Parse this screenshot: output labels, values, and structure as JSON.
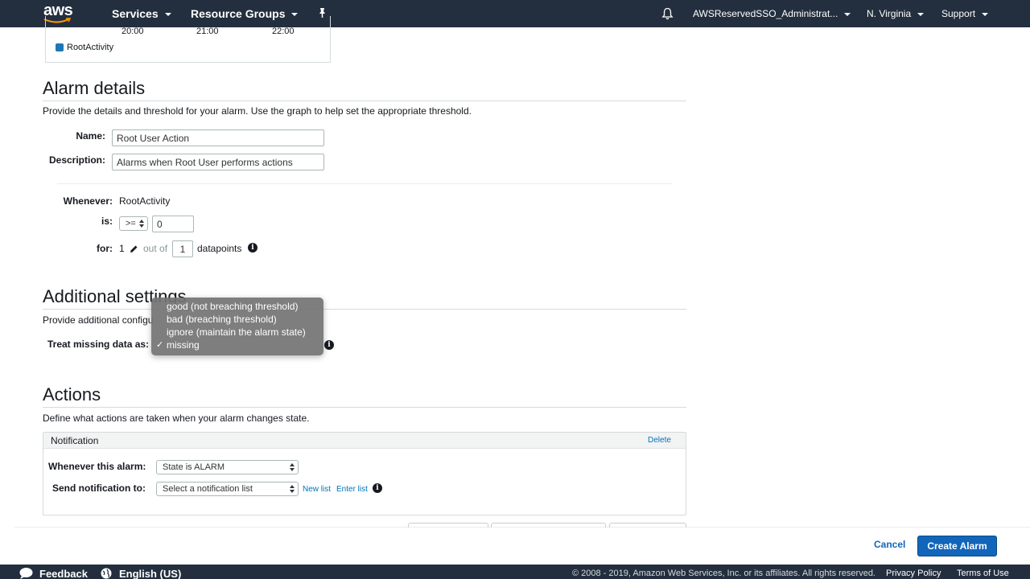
{
  "topnav": {
    "logo": "aws",
    "services": "Services",
    "resource_groups": "Resource Groups",
    "account": "AWSReservedSSO_Administrat...",
    "region": "N. Virginia",
    "support": "Support"
  },
  "graph": {
    "x_ticks": [
      "20:00",
      "21:00",
      "22:00"
    ],
    "legend": "RootActivity",
    "legend_color": "#1f77b4"
  },
  "alarm_details": {
    "title": "Alarm details",
    "description": "Provide the details and threshold for your alarm. Use the graph to help set the appropriate threshold.",
    "name_label": "Name:",
    "name_value": "Root User Action",
    "description_label": "Description:",
    "description_value": "Alarms when Root User performs actions",
    "whenever_label": "Whenever:",
    "whenever_value": "RootActivity",
    "is_label": "is:",
    "operator": ">=",
    "threshold": "0",
    "for_label": "for:",
    "for_value": "1",
    "out_of": "out of",
    "datapoints_value": "1",
    "datapoints_label": "datapoints"
  },
  "additional_settings": {
    "title": "Additional settings",
    "description": "Provide additional configu",
    "treat_missing_label": "Treat missing data as:",
    "dropdown_options": [
      "good (not breaching threshold)",
      "bad (breaching threshold)",
      "ignore (maintain the alarm state)",
      "missing"
    ],
    "selected_index": 3
  },
  "actions": {
    "title": "Actions",
    "description": "Define what actions are taken when your alarm changes state.",
    "notification_title": "Notification",
    "delete": "Delete",
    "whenever_alarm_label": "Whenever this alarm:",
    "state_value": "State is ALARM",
    "send_to_label": "Send notification to:",
    "send_to_placeholder": "Select a notification list",
    "new_list": "New list",
    "enter_list": "Enter list"
  },
  "buttons": {
    "cancel": "Cancel",
    "create": "Create Alarm"
  },
  "footer": {
    "feedback": "Feedback",
    "language": "English (US)",
    "copyright": "© 2008 - 2019, Amazon Web Services, Inc. or its affiliates. All rights reserved.",
    "privacy": "Privacy Policy",
    "terms": "Terms of Use"
  },
  "colors": {
    "nav_bg": "#232f3e",
    "primary_button": "#1166bb",
    "link": "#0073bb"
  }
}
